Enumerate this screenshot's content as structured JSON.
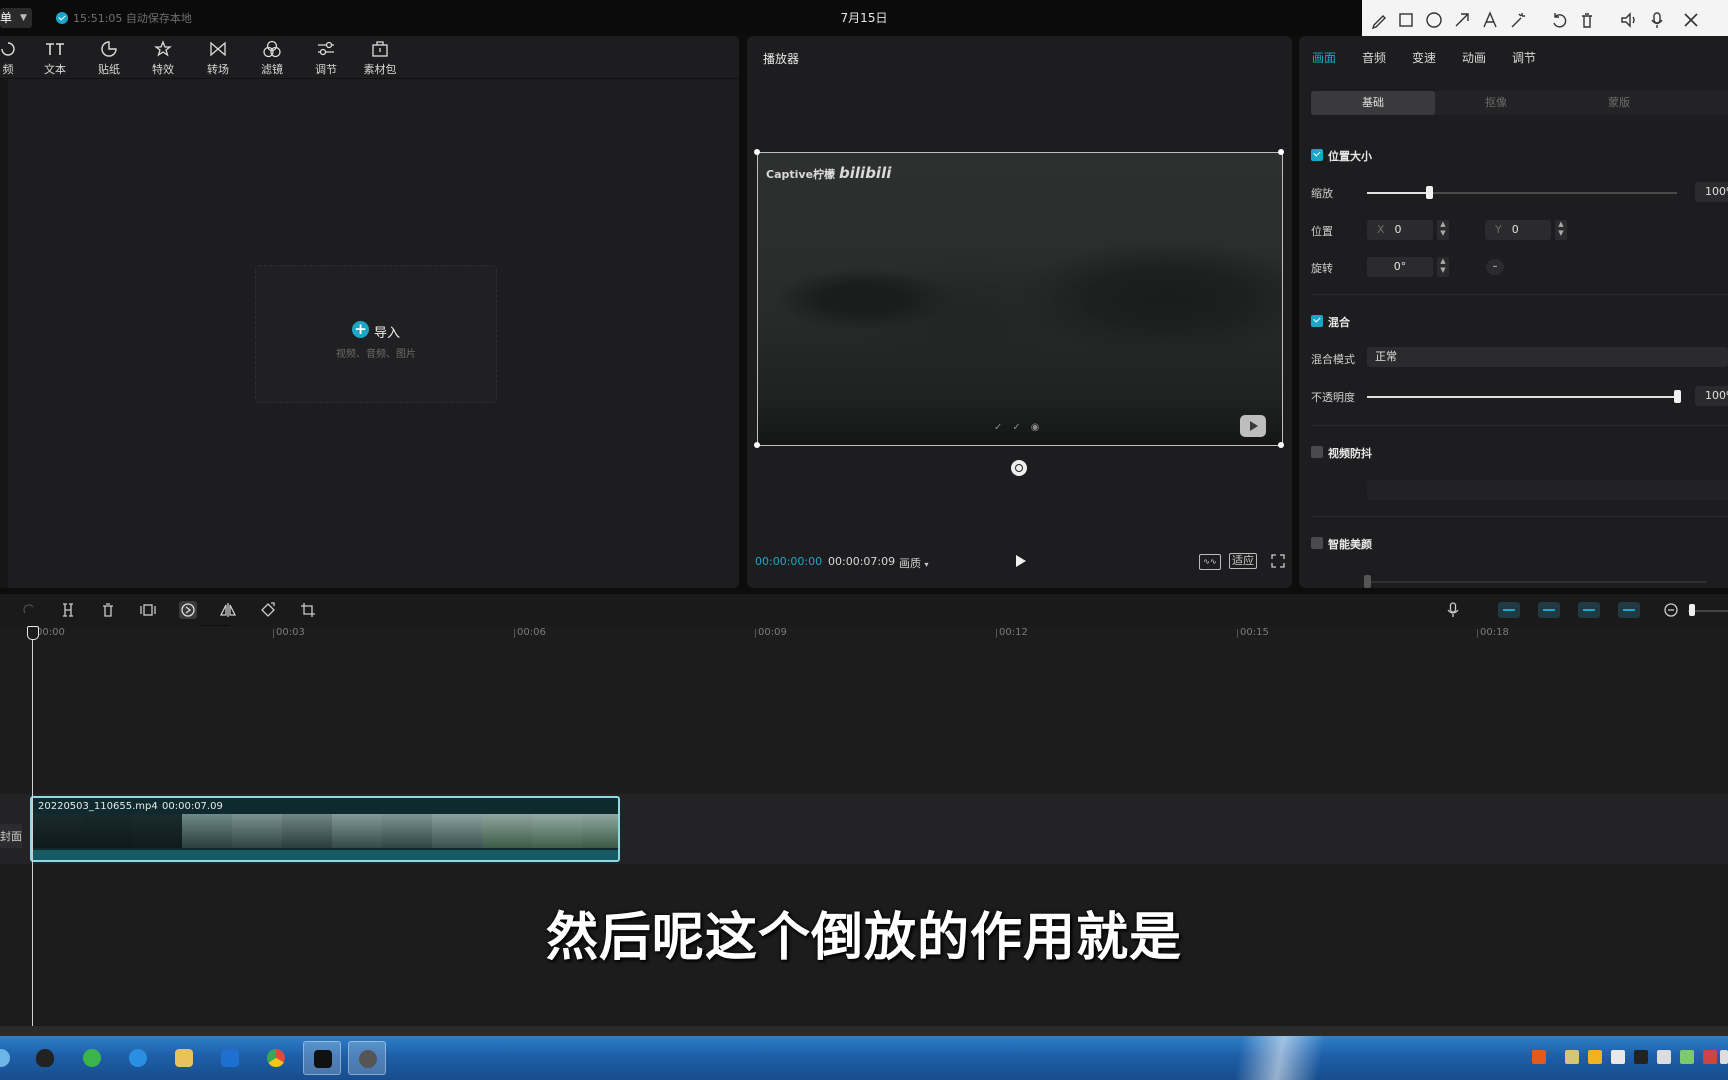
{
  "topbar": {
    "menu_label": "单",
    "save_status": "15:51:05 自动保存本地",
    "title": "7月15日"
  },
  "media_tabs": [
    {
      "label": "频",
      "icon": "audio-icon"
    },
    {
      "label": "文本",
      "icon": "text-icon"
    },
    {
      "label": "贴纸",
      "icon": "sticker-icon"
    },
    {
      "label": "特效",
      "icon": "effects-icon"
    },
    {
      "label": "转场",
      "icon": "transition-icon"
    },
    {
      "label": "滤镜",
      "icon": "filter-icon"
    },
    {
      "label": "调节",
      "icon": "adjust-icon"
    },
    {
      "label": "素材包",
      "icon": "package-icon"
    }
  ],
  "import": {
    "label": "导入",
    "hint": "视频、音频、图片"
  },
  "player": {
    "title": "播放器",
    "watermark": "Captive柠檬",
    "watermark_logo": "bilibili",
    "current_time": "00:00:00:00",
    "total_time": "00:00:07:09",
    "quality_label": "画质",
    "ratio_label": "适应"
  },
  "props": {
    "tabs": [
      "画面",
      "音频",
      "变速",
      "动画",
      "调节"
    ],
    "active_tab": "画面",
    "subtabs": [
      "基础",
      "抠像",
      "蒙版"
    ],
    "active_subtab": "基础",
    "position_size": {
      "title": "位置大小",
      "scale_label": "缩放",
      "scale_value": "100%",
      "scale_fraction": 0.2,
      "position_label": "位置",
      "x_axis": "X",
      "x_value": "0",
      "y_axis": "Y",
      "y_value": "0",
      "rotate_label": "旋转",
      "rotate_value": "0°"
    },
    "blend": {
      "title": "混合",
      "mode_label": "混合模式",
      "mode_value": "正常",
      "opacity_label": "不透明度",
      "opacity_value": "100%",
      "opacity_fraction": 1.0
    },
    "stabilize": {
      "title": "视频防抖"
    },
    "beauty": {
      "title": "智能美颜"
    }
  },
  "timeline_toolbar": {
    "tooltip": "倒放",
    "tools": [
      "undo-icon",
      "split-icon",
      "delete-icon",
      "freeze-icon",
      "reverse-icon",
      "mirror-icon",
      "rotate-icon",
      "crop-icon"
    ]
  },
  "timeline": {
    "ticks": [
      "00:00",
      "00:03",
      "00:06",
      "00:09",
      "00:12",
      "00:15",
      "00:18"
    ],
    "cover_label": "封面",
    "clip": {
      "filename": "20220503_110655.mp4",
      "duration": "00:00:07.09"
    }
  },
  "subtitle": "然后呢这个倒放的作用就是",
  "colors": {
    "accent": "#1aa7c7",
    "panel": "#1d1d1f",
    "background": "#0d0d0d",
    "clip_border": "#8fd9e6"
  }
}
